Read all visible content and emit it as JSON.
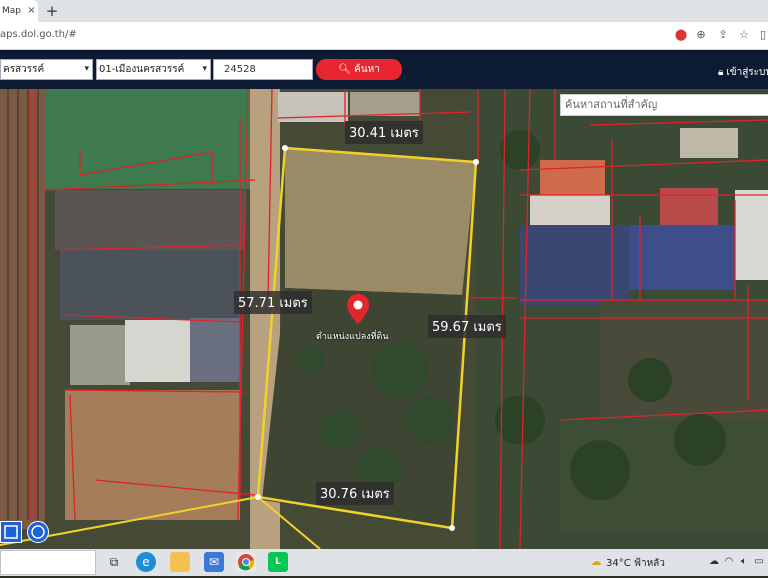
{
  "browser": {
    "tab_title": "Map",
    "tab_close": "×",
    "new_tab": "+",
    "url": "aps.dol.go.th/#"
  },
  "nav": {
    "province": "ครสวรรค์",
    "district": "01-เมืองนครสวรรค์",
    "parcel_no": "24528",
    "search_label": "ค้นหา",
    "login_label": "เข้าสู่ระบบ"
  },
  "map": {
    "poi_placeholder": "ค้นหาสถานที่สำคัญ",
    "pin_label": "ตำแหน่งแปลงที่ดิน",
    "dimensions": {
      "top": "30.41 เมตร",
      "left": "57.71 เมตร",
      "right": "59.67 เมตร",
      "bottom": "30.76 เมตร"
    }
  },
  "taskbar": {
    "weather": "34°C ฟ้าหลัว"
  },
  "colors": {
    "nav_bg": "#0d1a33",
    "search_button": "#e8262f",
    "parcel_outline": "#f2d02a",
    "neighbor_lines": "#e0222a"
  }
}
